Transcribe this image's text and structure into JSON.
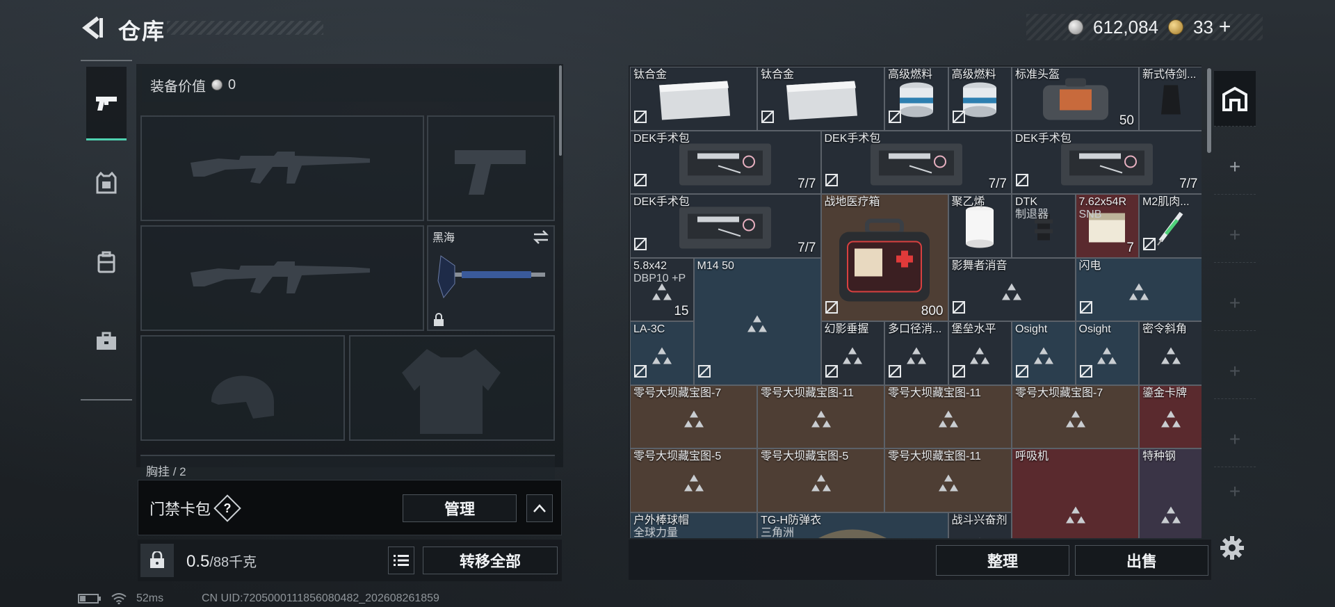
{
  "header": {
    "title": "仓库"
  },
  "currency": {
    "silver": "612,084",
    "gold": "33",
    "plus": "+"
  },
  "equipment": {
    "value_label": "装备价值",
    "value": "0",
    "melee_name": "黑海",
    "partial_row": "胸挂 / 2"
  },
  "keycard": {
    "label": "门禁卡包",
    "help": "?",
    "manage": "管理"
  },
  "weight": {
    "value": "0.5",
    "unit": "/88千克",
    "transfer_all": "转移全部"
  },
  "status": {
    "ping": "52ms",
    "uid": "CN UID:7205000111856080482_202608261859"
  },
  "actions": {
    "sort": "整理",
    "sell": "出售"
  },
  "grid": {
    "items": [
      {
        "name": "钛合金",
        "count": ""
      },
      {
        "name": "钛合金",
        "count": ""
      },
      {
        "name": "高级燃料",
        "count": ""
      },
      {
        "name": "高级燃料",
        "count": ""
      },
      {
        "name": "标准头盔",
        "count": "50"
      },
      {
        "name": "新式侍剑...",
        "count": ""
      },
      {
        "name": "DEK手术包",
        "count": "7/7"
      },
      {
        "name": "DEK手术包",
        "count": "7/7"
      },
      {
        "name": "DEK手术包",
        "count": "7/7"
      },
      {
        "name": "DEK手术包",
        "count": "7/7"
      },
      {
        "name": "战地医疗箱",
        "count": "800"
      },
      {
        "name": "聚乙烯",
        "count": ""
      },
      {
        "name": "DTK",
        "name2": "制退器",
        "count": ""
      },
      {
        "name": "7.62x54R",
        "name2": "SNB",
        "count": "7"
      },
      {
        "name": "M2肌肉...",
        "count": ""
      },
      {
        "name": "5.8x42",
        "name2": "DBP10 +P",
        "count": "15"
      },
      {
        "name": "M14 50",
        "count": ""
      },
      {
        "name": "影舞者消音",
        "count": ""
      },
      {
        "name": "闪电",
        "count": ""
      },
      {
        "name": "LA-3C",
        "count": ""
      },
      {
        "name": "幻影垂握",
        "count": ""
      },
      {
        "name": "多口径消...",
        "count": ""
      },
      {
        "name": "堡垒水平",
        "count": ""
      },
      {
        "name": "Osight",
        "count": ""
      },
      {
        "name": "Osight",
        "count": ""
      },
      {
        "name": "密令斜角",
        "count": ""
      },
      {
        "name": "零号大坝藏宝图-7",
        "count": ""
      },
      {
        "name": "零号大坝藏宝图-11",
        "count": ""
      },
      {
        "name": "零号大坝藏宝图-11",
        "count": ""
      },
      {
        "name": "零号大坝藏宝图-7",
        "count": ""
      },
      {
        "name": "鎏金卡牌",
        "count": ""
      },
      {
        "name": "零号大坝藏宝图-5",
        "count": ""
      },
      {
        "name": "零号大坝藏宝图-5",
        "count": ""
      },
      {
        "name": "零号大坝藏宝图-11",
        "count": ""
      },
      {
        "name": "呼吸机",
        "count": ""
      },
      {
        "name": "特种钢",
        "count": ""
      },
      {
        "name": "户外棒球帽",
        "name2": "全球力量",
        "count": ""
      },
      {
        "name": "TG-H防弹衣",
        "name2": "三角洲",
        "count": ""
      },
      {
        "name": "战斗兴奋剂",
        "count": ""
      }
    ]
  },
  "colors": {
    "accent": "#4fd1b0",
    "cell_default": "#262d36",
    "cell_blue": "#2b3e4e",
    "cell_brown": "#4e3e34",
    "cell_red": "#5a2a2e",
    "cell_purple": "#3a3446"
  }
}
